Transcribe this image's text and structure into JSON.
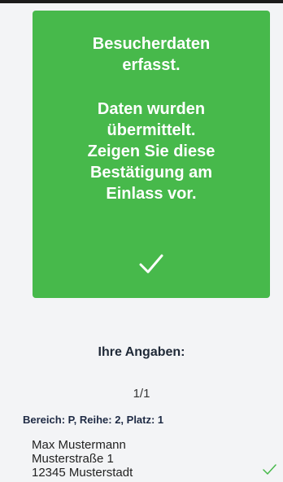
{
  "confirmation": {
    "line1": "Besucherdaten",
    "line2": "erfasst.",
    "line3": "Daten wurden",
    "line4": "übermittelt.",
    "line5": "Zeigen Sie diese",
    "line6": "Bestätigung am",
    "line7": "Einlass vor.",
    "icon": "check-icon",
    "background_color": "#47b94b"
  },
  "details": {
    "heading": "Ihre Angaben:",
    "pager": "1/1",
    "seat": "Bereich: P, Reihe: 2, Platz: 1",
    "name": "Max Mustermann",
    "street": "Musterstraße 1",
    "city": "12345 Musterstadt",
    "status_icon": "check-icon"
  }
}
